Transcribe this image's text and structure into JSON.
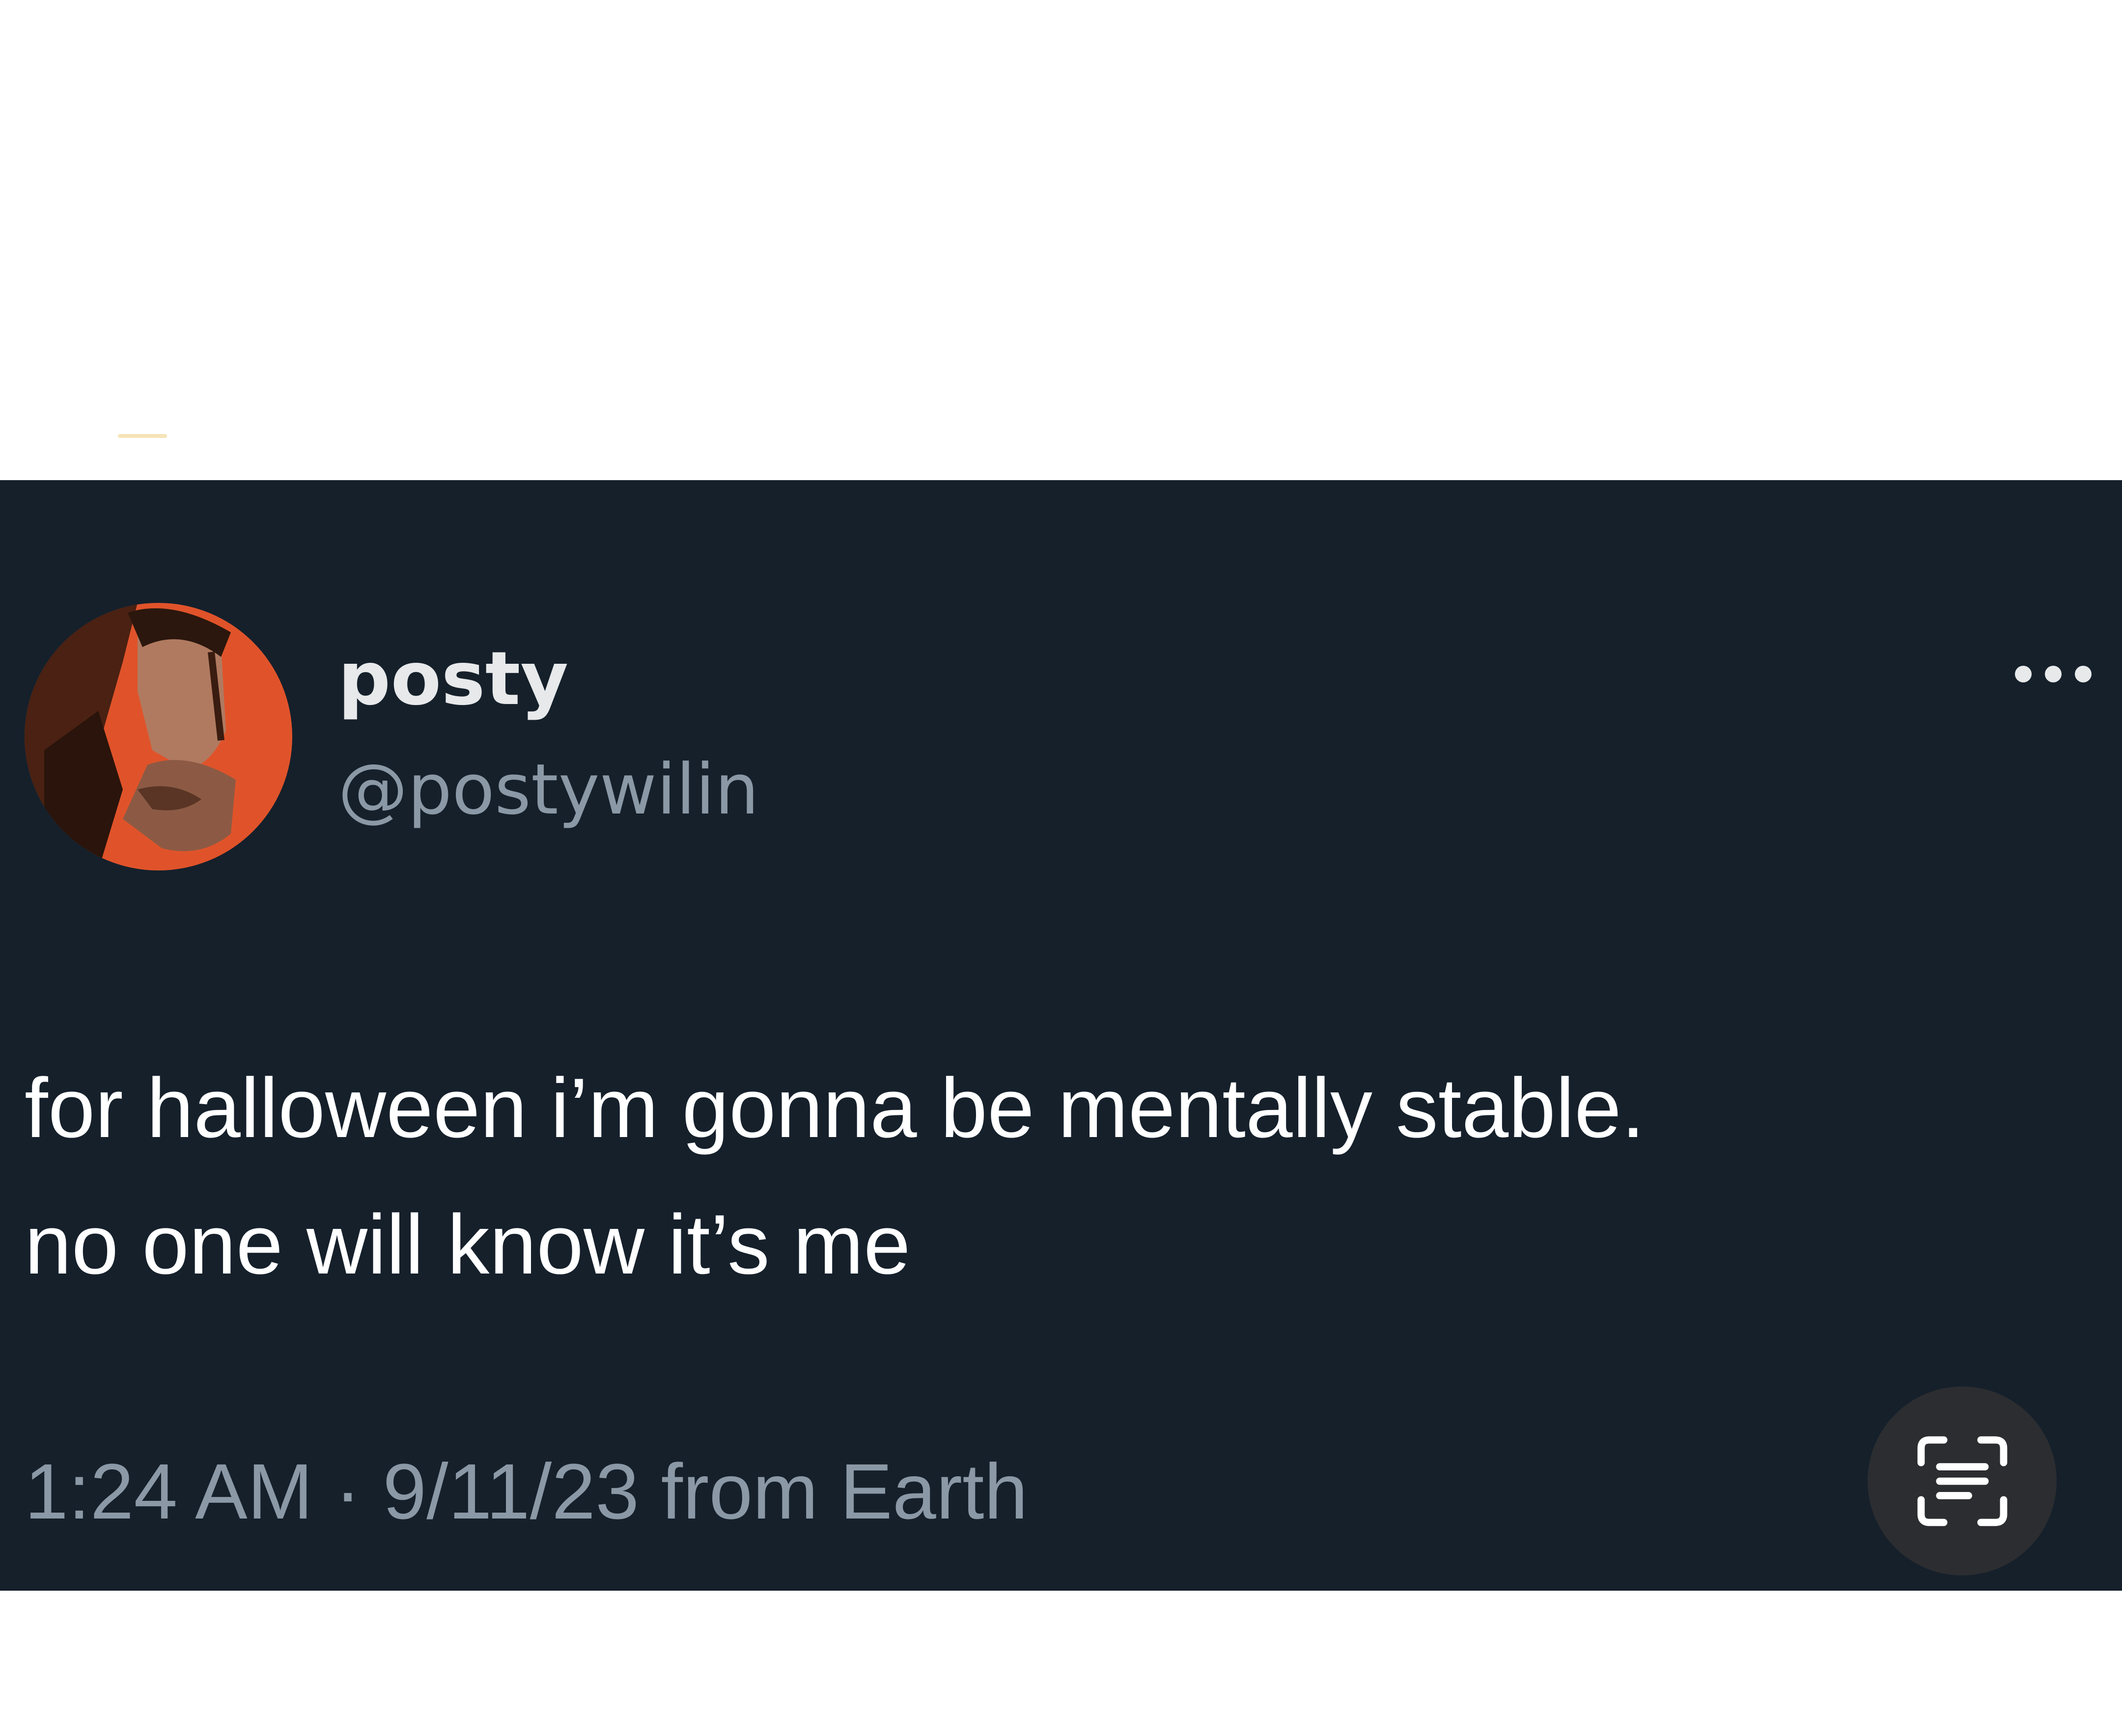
{
  "tweet": {
    "author": {
      "display_name": "posty",
      "handle": "@postywilin",
      "avatar_icon": "profile-photo",
      "avatar_bg_color": "#e0532a"
    },
    "text_lines": [
      "for halloween i’m gonna be mentally stable.",
      "no one will know it’s me"
    ],
    "timestamp": "1:24 AM · 9/11/23 from Earth",
    "more_icon": "more-horizontal-icon",
    "scan_icon": "scan-text-icon"
  },
  "colors": {
    "card_background": "#15202b",
    "primary_text": "#e7e9ea",
    "secondary_text": "#8b98a5",
    "page_background": "#ffffff"
  }
}
